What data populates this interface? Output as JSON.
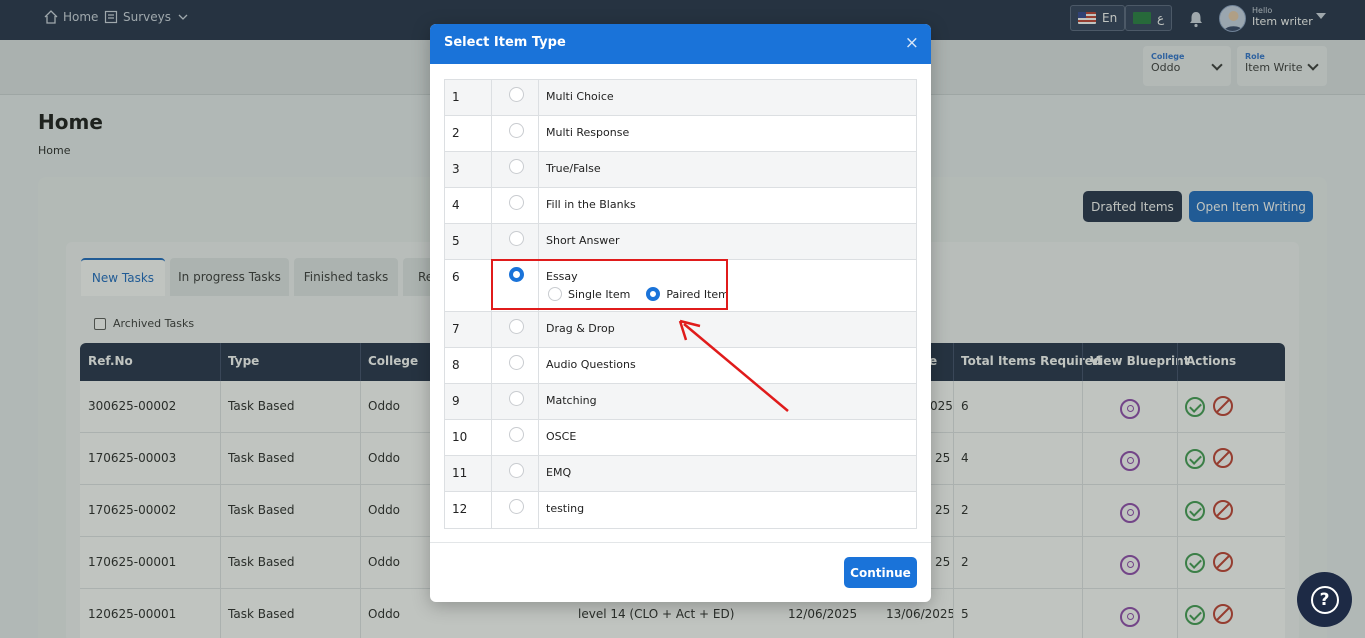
{
  "topbar": {
    "home": "Home",
    "surveys": "Surveys",
    "lang_en": "En",
    "lang_ar": "ع",
    "hello": "Hello",
    "user_name": "Item writer"
  },
  "selectors": {
    "college_label": "College",
    "college_value": "Oddo",
    "role_label": "Role",
    "role_value": "Item Write"
  },
  "page": {
    "title": "Home",
    "breadcrumb": "Home",
    "drafted_label": "Drafted Items",
    "open_writing_label": "Open Item Writing"
  },
  "tabs": [
    "New Tasks",
    "In progress Tasks",
    "Finished tasks",
    "Re"
  ],
  "archived_label": "Archived Tasks",
  "table": {
    "headers": [
      "Ref.No",
      "Type",
      "College",
      "e",
      "Total Items Required",
      "View Blueprint",
      "Actions"
    ],
    "rows": [
      {
        "ref": "300625-00002",
        "type": "Task Based",
        "college": "Oddo",
        "extra": "",
        "date1": "",
        "date2": "025",
        "total": "6"
      },
      {
        "ref": "170625-00003",
        "type": "Task Based",
        "college": "Oddo",
        "extra": "",
        "date1": "",
        "date2": "25",
        "total": "4"
      },
      {
        "ref": "170625-00002",
        "type": "Task Based",
        "college": "Oddo",
        "extra": "",
        "date1": "",
        "date2": "25",
        "total": "2"
      },
      {
        "ref": "170625-00001",
        "type": "Task Based",
        "college": "Oddo",
        "extra": "",
        "date1": "",
        "date2": "25",
        "total": "2"
      },
      {
        "ref": "120625-00001",
        "type": "Task Based",
        "college": "Oddo",
        "extra": "level 14 (CLO + Act + ED)",
        "date1": "12/06/2025",
        "date2": "13/06/2025",
        "total": "5"
      }
    ]
  },
  "modal": {
    "title": "Select Item Type",
    "close": "×",
    "continue_label": "Continue",
    "items": [
      {
        "num": "1",
        "label": "Multi Choice"
      },
      {
        "num": "2",
        "label": "Multi Response"
      },
      {
        "num": "3",
        "label": "True/False"
      },
      {
        "num": "4",
        "label": "Fill in the Blanks"
      },
      {
        "num": "5",
        "label": "Short Answer"
      },
      {
        "num": "6",
        "label": "Essay"
      },
      {
        "num": "7",
        "label": "Drag & Drop"
      },
      {
        "num": "8",
        "label": "Audio Questions"
      },
      {
        "num": "9",
        "label": "Matching"
      },
      {
        "num": "10",
        "label": "OSCE"
      },
      {
        "num": "11",
        "label": "EMQ"
      },
      {
        "num": "12",
        "label": "testing"
      }
    ],
    "essay_options": {
      "single": "Single Item",
      "paired": "Paired Item"
    }
  },
  "colors": {
    "primary": "#1a73d9",
    "navy": "#1d2a45",
    "annotation": "#e01b1b"
  }
}
